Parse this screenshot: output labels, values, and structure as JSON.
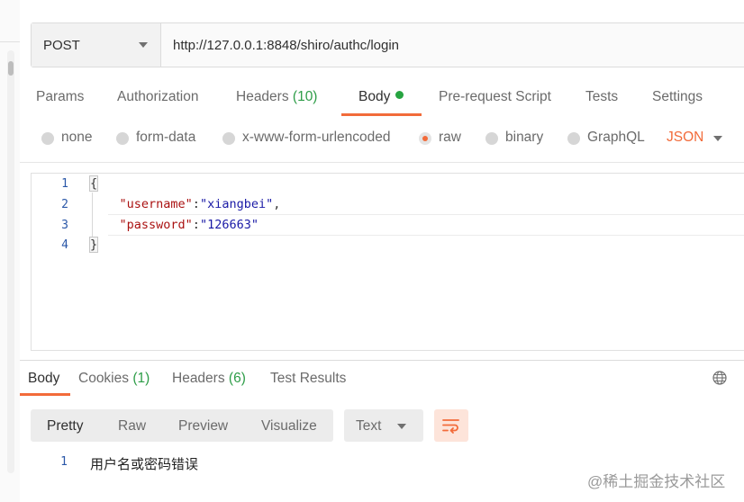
{
  "request": {
    "method": "POST",
    "url": "http://127.0.0.1:8848/shiro/authc/login"
  },
  "request_tabs": [
    {
      "label": "Params"
    },
    {
      "label": "Authorization"
    },
    {
      "label": "Headers",
      "count": "(10)"
    },
    {
      "label": "Body",
      "active": true
    },
    {
      "label": "Pre-request Script"
    },
    {
      "label": "Tests"
    },
    {
      "label": "Settings"
    }
  ],
  "body_types": [
    {
      "label": "none"
    },
    {
      "label": "form-data"
    },
    {
      "label": "x-www-form-urlencoded"
    },
    {
      "label": "raw",
      "selected": true
    },
    {
      "label": "binary"
    },
    {
      "label": "GraphQL"
    }
  ],
  "raw_format": "JSON",
  "editor": {
    "line_numbers": [
      "1",
      "2",
      "3",
      "4"
    ],
    "open_brace": "{",
    "close_brace": "}",
    "username_key": "\"username\"",
    "username_value": "\"xiangbei\"",
    "password_key": "\"password\"",
    "password_value": "\"126663\""
  },
  "response_tabs": [
    {
      "label": "Body",
      "active": true
    },
    {
      "label": "Cookies",
      "count": "(1)"
    },
    {
      "label": "Headers",
      "count": "(6)"
    },
    {
      "label": "Test Results"
    }
  ],
  "view_modes": [
    "Pretty",
    "Raw",
    "Preview",
    "Visualize"
  ],
  "response_format": "Text",
  "response": {
    "line_number": "1",
    "text": "用户名或密码错误"
  },
  "watermark": "@稀土掘金技术社区",
  "colors": {
    "accent": "#f26b3a",
    "count_green": "#2e9d48",
    "status_dot": "#27a441"
  },
  "icons": [
    "caret-down-icon",
    "status-dot-icon",
    "globe-icon",
    "wrap-lines-icon"
  ]
}
